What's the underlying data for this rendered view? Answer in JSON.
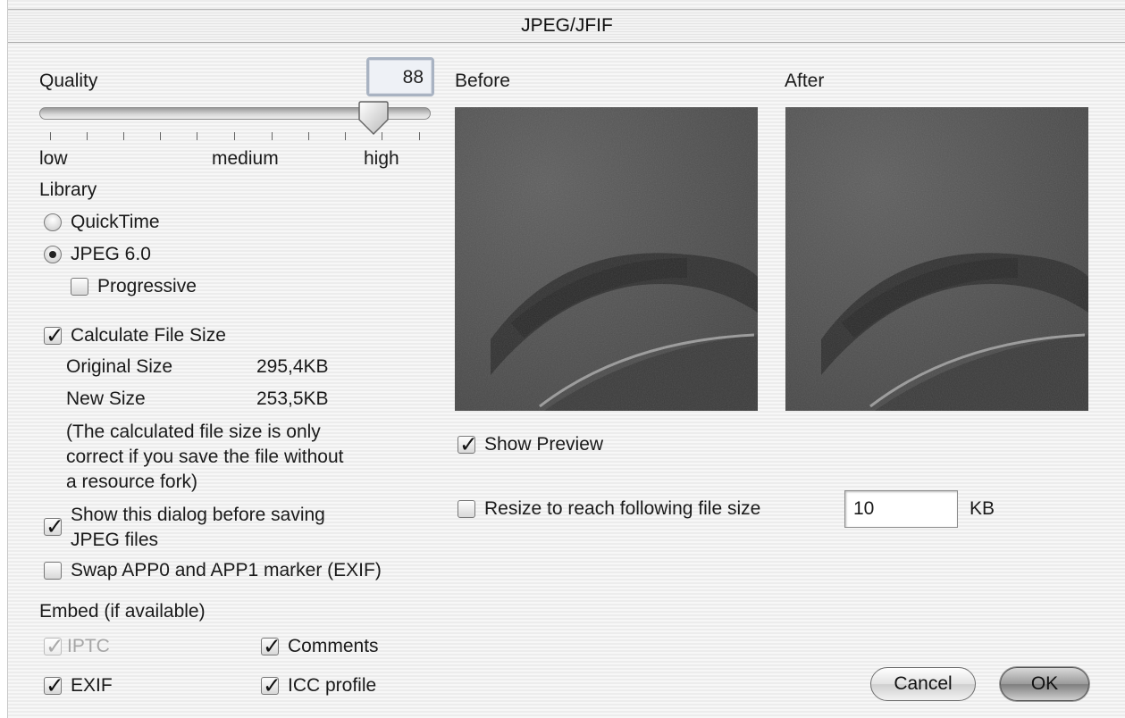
{
  "window": {
    "title": "JPEG/JFIF"
  },
  "quality": {
    "label": "Quality",
    "value": "88",
    "slider_fraction": 0.85,
    "low_label": "low",
    "medium_label": "medium",
    "high_label": "high"
  },
  "library": {
    "heading": "Library",
    "options": [
      {
        "label": "QuickTime",
        "selected": false
      },
      {
        "label": "JPEG 6.0",
        "selected": true
      }
    ],
    "progressive": {
      "label": "Progressive",
      "checked": false
    }
  },
  "file_size": {
    "calculate": {
      "label": "Calculate File Size",
      "checked": true
    },
    "original_label": "Original Size",
    "original_value": "295,4KB",
    "new_label": "New Size",
    "new_value": "253,5KB",
    "note_line1": "(The calculated file size is only",
    "note_line2": "correct if you save the file without",
    "note_line3": "a resource fork)"
  },
  "show_dialog": {
    "label_line1": "Show this dialog before saving",
    "label_line2": "JPEG files",
    "checked": true
  },
  "swap_markers": {
    "label": "Swap APP0 and APP1 marker (EXIF)",
    "checked": false
  },
  "embed": {
    "heading": "Embed (if available)",
    "iptc": {
      "label": "IPTC",
      "checked": true,
      "enabled": false
    },
    "comments": {
      "label": "Comments",
      "checked": true
    },
    "exif": {
      "label": "EXIF",
      "checked": true
    },
    "icc": {
      "label": "ICC profile",
      "checked": true
    }
  },
  "preview": {
    "before_label": "Before",
    "after_label": "After",
    "show_preview": {
      "label": "Show Preview",
      "checked": true
    }
  },
  "resize": {
    "label": "Resize to reach following file size",
    "checked": false,
    "value": "10",
    "unit": "KB"
  },
  "buttons": {
    "cancel": "Cancel",
    "ok": "OK"
  },
  "icons": {
    "checkbox": "checkmark-icon",
    "radio": "radio-dot-icon",
    "slider": "slider-thumb-icon"
  }
}
